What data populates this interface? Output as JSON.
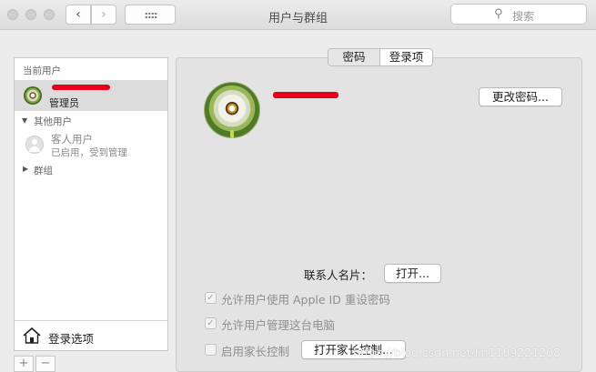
{
  "window": {
    "title": "用户与群组",
    "nav_back": "‹",
    "nav_forward": "›",
    "search_placeholder": "搜索"
  },
  "sidebar": {
    "current_users_label": "当前用户",
    "current_user": {
      "role": "管理员"
    },
    "other_users_label": "其他用户",
    "guest": {
      "name": "客人用户",
      "status": "已启用，受到管理"
    },
    "groups_label": "群组",
    "login_options_label": "登录选项",
    "add_label": "+",
    "remove_label": "−"
  },
  "tabs": [
    {
      "label": "密码",
      "active": false
    },
    {
      "label": "登录项",
      "active": true
    }
  ],
  "main": {
    "change_password_button": "更改密码...",
    "contact_card_label": "联系人名片：",
    "open_button": "打开...",
    "allow_apple_id_reset": {
      "label": "允许用户使用 Apple ID 重设密码",
      "checked": true
    },
    "allow_admin": {
      "label": "允许用户管理这台电脑",
      "checked": true
    },
    "parental_controls": {
      "label": "启用家长控制",
      "checked": false
    },
    "open_parental_controls_button": "打开家长控制..."
  },
  "watermark": "https://blog.csdn.net/lin1109221208",
  "colors": {
    "redaction": "#e8001a",
    "selection": "#dcdcdc"
  }
}
